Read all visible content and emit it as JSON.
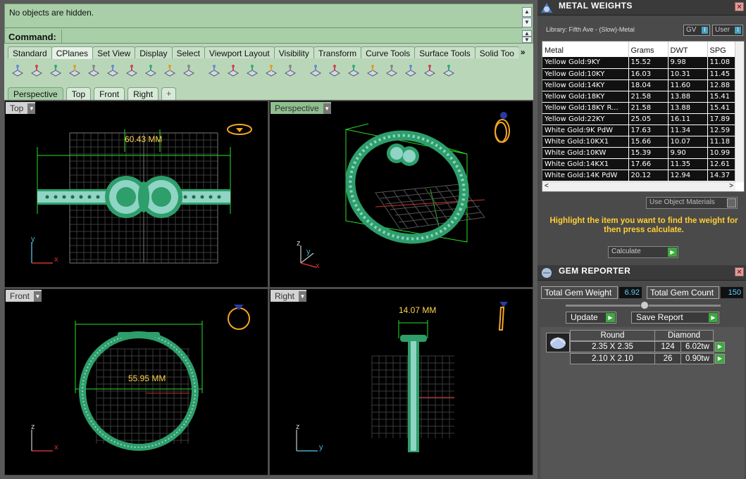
{
  "command": {
    "history": "No objects are hidden.",
    "prompt_label": "Command:"
  },
  "toolbar_tabs": [
    "Standard",
    "CPlanes",
    "Set View",
    "Display",
    "Select",
    "Viewport Layout",
    "Visibility",
    "Transform",
    "Curve Tools",
    "Surface Tools",
    "Solid Too"
  ],
  "toolbar_more": "»",
  "toolbar_icons": [
    "cplane-icon",
    "cplane-origin-icon",
    "cplane-object-icon",
    "cplane-surface-icon",
    "cplane-curve-icon",
    "cplane-rotate-icon",
    "cplane-xaxis-icon",
    "cplane-3point-icon",
    "cplane-elevation-icon",
    "cplane-zaxis-icon",
    "undo-cplane-icon",
    "cplane-view-icon",
    "cplane-grid-icon",
    "save-cplane-icon",
    "open-cplane-icon",
    "cplane-world-icon",
    "cplane-top-icon",
    "cplane-bottom-icon",
    "cplane-front-icon",
    "cplane-back-icon",
    "cplane-right-icon",
    "cplane-left-icon",
    "cplane-3d-icon"
  ],
  "viewport_tabs": [
    "Perspective",
    "Top",
    "Front",
    "Right",
    "+"
  ],
  "viewports": {
    "top": {
      "title": "Top",
      "dimension": "60.43 MM",
      "axis_x": "x",
      "axis_y": "y"
    },
    "perspective": {
      "title": "Perspective",
      "axis_x": "x",
      "axis_y": "y",
      "axis_z": "z"
    },
    "front": {
      "title": "Front",
      "dimension": "55.95 MM",
      "axis_x": "x",
      "axis_z": "z"
    },
    "right": {
      "title": "Right",
      "dimension": "14.07 MM",
      "axis_y": "y",
      "axis_z": "z"
    }
  },
  "metal_weights": {
    "title": "METAL WEIGHTS",
    "library": "Library: Fifth Ave - (Slow)-Metal",
    "toggle_gv": "GV",
    "toggle_user": "User",
    "columns": [
      "Metal",
      "Grams",
      "DWT",
      "SPG"
    ],
    "rows": [
      [
        "Yellow Gold:9KY",
        "15.52",
        "9.98",
        "11.08"
      ],
      [
        "Yellow Gold:10KY",
        "16.03",
        "10.31",
        "11.45"
      ],
      [
        "Yellow Gold:14KY",
        "18.04",
        "11.60",
        "12.88"
      ],
      [
        "Yellow Gold:18KY",
        "21.58",
        "13.88",
        "15.41"
      ],
      [
        "Yellow Gold:18KY R...",
        "21.58",
        "13.88",
        "15.41"
      ],
      [
        "Yellow Gold:22KY",
        "25.05",
        "16.11",
        "17.89"
      ],
      [
        "White Gold:9K PdW",
        "17.63",
        "11.34",
        "12.59"
      ],
      [
        "White Gold:10KX1",
        "15.66",
        "10.07",
        "11.18"
      ],
      [
        "White Gold:10KW",
        "15.39",
        "9.90",
        "10.99"
      ],
      [
        "White Gold:14KX1",
        "17.66",
        "11.35",
        "12.61"
      ],
      [
        "White Gold:14K PdW",
        "20.12",
        "12.94",
        "14.37"
      ]
    ],
    "use_object_materials": "Use Object Materials",
    "instruction": "Highlight the item you want to find the weight for then press calculate.",
    "calculate": "Calculate"
  },
  "gem_reporter": {
    "title": "GEM REPORTER",
    "total_weight_label": "Total Gem Weight",
    "total_weight": "6.92",
    "total_count_label": "Total Gem Count",
    "total_count": "150",
    "update": "Update",
    "save_report": "Save Report",
    "shape": "Round",
    "type": "Diamond",
    "gems": [
      {
        "size": "2.35 X 2.35",
        "count": "124",
        "tw": "6.02tw"
      },
      {
        "size": "2.10 X 2.10",
        "count": "26",
        "tw": "0.90tw"
      }
    ]
  },
  "colors": {
    "accent_green": "#a9cfa9",
    "viewport_bg": "#000000",
    "instruction_yellow": "#ffcf33"
  }
}
